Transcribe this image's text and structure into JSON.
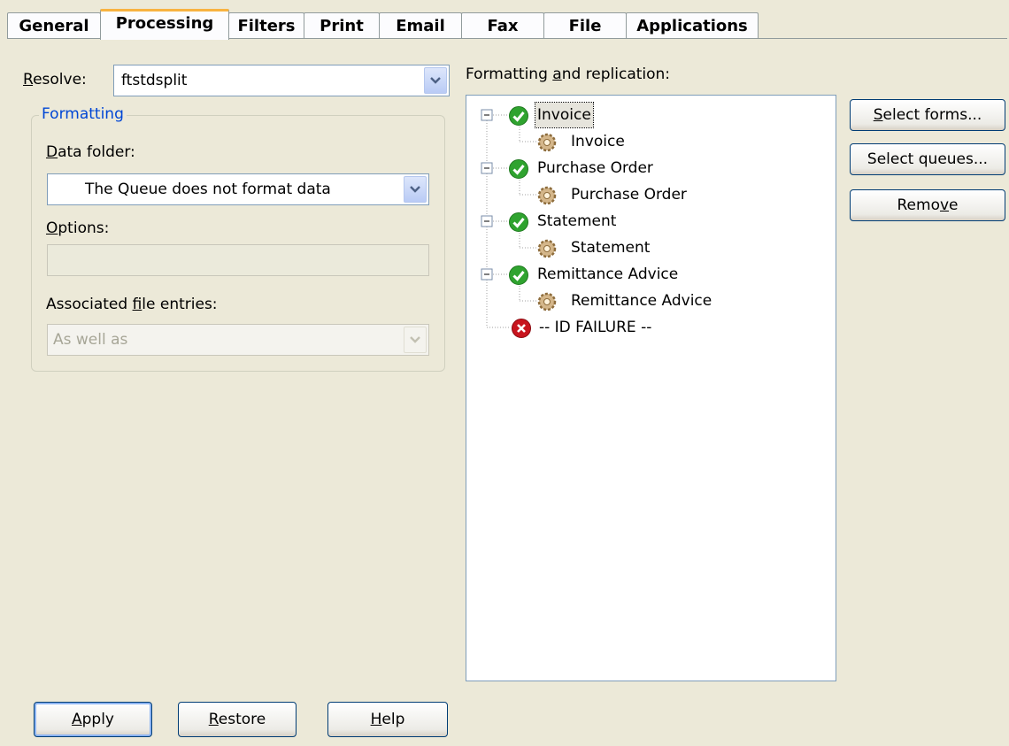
{
  "tabs": [
    {
      "label": "General"
    },
    {
      "label": "Processing"
    },
    {
      "label": "Filters"
    },
    {
      "label": "Print"
    },
    {
      "label": "Email"
    },
    {
      "label": "Fax"
    },
    {
      "label": "File"
    },
    {
      "label": "Applications"
    }
  ],
  "active_tab": "Processing",
  "resolve": {
    "label_pre": "",
    "label_key": "R",
    "label_post": "esolve:",
    "value": "ftstdsplit"
  },
  "formatting": {
    "legend": "Formatting",
    "data_folder": {
      "label_pre": "",
      "label_key": "D",
      "label_post": "ata folder:",
      "value": "The Queue does not format data"
    },
    "options": {
      "label_pre": "",
      "label_key": "O",
      "label_post": "ptions:",
      "value": ""
    },
    "associated": {
      "label_pre": "Associated ",
      "label_key": "f",
      "label_post": "ile entries:",
      "value": "As well as"
    }
  },
  "tree": {
    "label_pre": "Formatting ",
    "label_key": "a",
    "label_post": "nd replication:",
    "items": [
      {
        "kind": "form",
        "label": "Invoice",
        "child": "Invoice"
      },
      {
        "kind": "form",
        "label": "Purchase Order",
        "child": "Purchase Order"
      },
      {
        "kind": "form",
        "label": "Statement",
        "child": "Statement"
      },
      {
        "kind": "form",
        "label": "Remittance Advice",
        "child": "Remittance Advice"
      }
    ],
    "failure_label": "-- ID FAILURE --"
  },
  "side_buttons": {
    "select_forms": {
      "pre": "",
      "key": "S",
      "post": "elect forms..."
    },
    "select_queues": {
      "pre": "Select queues...",
      "key": "",
      "post": ""
    },
    "remove": {
      "pre": "Remo",
      "key": "v",
      "post": "e"
    }
  },
  "footer_buttons": {
    "apply": {
      "pre": "",
      "key": "A",
      "post": "pply"
    },
    "restore": {
      "pre": "",
      "key": "R",
      "post": "estore"
    },
    "help": {
      "pre": "",
      "key": "H",
      "post": "elp"
    }
  },
  "colors": {
    "active_tab_accent": "#f8b340",
    "group_legend": "#0046d5",
    "ok_icon": "#2fa32f",
    "error_icon": "#c8141e"
  }
}
